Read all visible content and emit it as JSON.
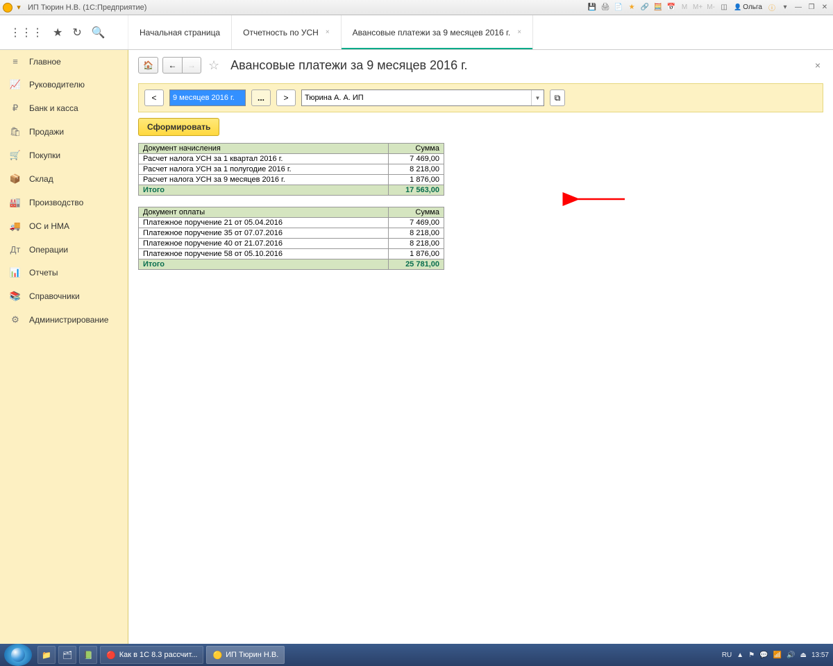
{
  "title": "ИП Тюрин Н.В.  (1С:Предприятие)",
  "user": "Ольга",
  "toolbar_m": [
    "M",
    "M+",
    "M-"
  ],
  "tabs": [
    {
      "label": "Начальная страница",
      "closable": false
    },
    {
      "label": "Отчетность по УСН",
      "closable": true
    },
    {
      "label": "Авансовые платежи за 9 месяцев 2016 г.",
      "closable": true,
      "active": true
    }
  ],
  "sidebar": [
    {
      "icon": "≡",
      "label": "Главное"
    },
    {
      "icon": "📈",
      "label": "Руководителю"
    },
    {
      "icon": "₽",
      "label": "Банк и касса"
    },
    {
      "icon": "🛍",
      "label": "Продажи"
    },
    {
      "icon": "🛒",
      "label": "Покупки"
    },
    {
      "icon": "📦",
      "label": "Склад"
    },
    {
      "icon": "🏭",
      "label": "Производство"
    },
    {
      "icon": "🚚",
      "label": "ОС и НМА"
    },
    {
      "icon": "Дт",
      "label": "Операции"
    },
    {
      "icon": "📊",
      "label": "Отчеты"
    },
    {
      "icon": "📚",
      "label": "Справочники"
    },
    {
      "icon": "⚙",
      "label": "Администрирование"
    }
  ],
  "page": {
    "title": "Авансовые платежи за 9 месяцев 2016 г.",
    "period": "9 месяцев 2016 г.",
    "org": "Тюрина А. А. ИП",
    "generate": "Сформировать"
  },
  "table1": {
    "col_doc": "Документ начисления",
    "col_sum": "Сумма",
    "rows": [
      {
        "doc": "Расчет налога УСН  за 1 квартал 2016 г.",
        "sum": "7 469,00"
      },
      {
        "doc": "Расчет налога УСН  за 1 полугодие 2016 г.",
        "sum": "8 218,00"
      },
      {
        "doc": "Расчет налога УСН  за 9 месяцев 2016 г.",
        "sum": "1 876,00"
      }
    ],
    "total_label": "Итого",
    "total_sum": "17 563,00"
  },
  "table2": {
    "col_doc": "Документ оплаты",
    "col_sum": "Сумма",
    "rows": [
      {
        "doc": "Платежное поручение 21 от 05.04.2016",
        "sum": "7 469,00"
      },
      {
        "doc": "Платежное поручение 35 от 07.07.2016",
        "sum": "8 218,00"
      },
      {
        "doc": "Платежное поручение 40 от 21.07.2016",
        "sum": "8 218,00"
      },
      {
        "doc": "Платежное поручение 58 от 05.10.2016",
        "sum": "1 876,00"
      }
    ],
    "total_label": "Итого",
    "total_sum": "25 781,00"
  },
  "taskbar": {
    "items": [
      {
        "label": "Как в 1С 8.3 рассчит...",
        "icon": "🔴"
      },
      {
        "label": "ИП Тюрин Н.В.",
        "icon": "🟡",
        "active": true
      }
    ],
    "lang": "RU",
    "time": "13:57"
  }
}
